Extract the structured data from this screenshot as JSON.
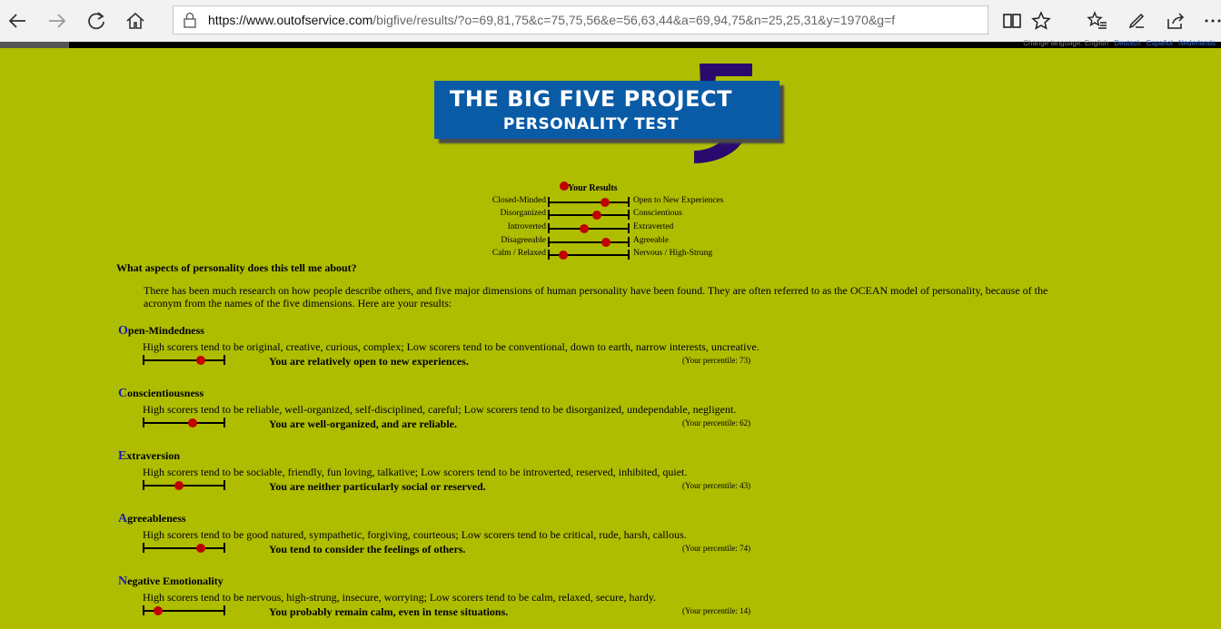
{
  "browser": {
    "url_host": "https://www.outofservice.com",
    "url_path": "/bigfive/results/?o=69,81,75&c=75,75,56&e=56,63,44&a=69,94,75&n=25,25,31&y=1970&g=f",
    "language_text": "Change language: English",
    "language_links": [
      "Deutsch",
      "Español",
      "Nederlands"
    ]
  },
  "logo": {
    "line1": "THE BIG FIVE PROJECT",
    "line2": "PERSONALITY TEST",
    "number": "5"
  },
  "summary": {
    "legend": "Your Results",
    "rows": [
      {
        "left": "Closed-Minded",
        "right": "Open to New Experiences",
        "value": 73
      },
      {
        "left": "Disorganized",
        "right": "Conscientious",
        "value": 62
      },
      {
        "left": "Introverted",
        "right": "Extraverted",
        "value": 43
      },
      {
        "left": "Disagreeable",
        "right": "Agreeable",
        "value": 74
      },
      {
        "left": "Calm / Relaxed",
        "right": "Nervous / High-Strung",
        "value": 14
      }
    ]
  },
  "question": "What aspects of personality does this tell me about?",
  "intro": "There has been much research on how people describe others, and five major dimensions of human personality have been found. They are often referred to as the OCEAN model of personality, because of the acronym from the names of the five dimensions. Here are your results:",
  "traits": [
    {
      "initial": "O",
      "rest": "pen-Mindedness",
      "desc": "High scorers tend to be original, creative, curious, complex; Low scorers tend to be conventional, down to earth, narrow interests, uncreative.",
      "verdict": "You are relatively open to new experiences.",
      "percentile_text": "(Your percentile: 73)",
      "value": 73
    },
    {
      "initial": "C",
      "rest": "onscientiousness",
      "desc": "High scorers tend to be reliable, well-organized, self-disciplined, careful; Low scorers tend to be disorganized, undependable, negligent.",
      "verdict": "You are well-organized, and are reliable.",
      "percentile_text": "(Your percentile: 62)",
      "value": 62
    },
    {
      "initial": "E",
      "rest": "xtraversion",
      "desc": "High scorers tend to be sociable, friendly, fun loving, talkative; Low scorers tend to be introverted, reserved, inhibited, quiet.",
      "verdict": "You are neither particularly social or reserved.",
      "percentile_text": "(Your percentile: 43)",
      "value": 43
    },
    {
      "initial": "A",
      "rest": "greeableness",
      "desc": "High scorers tend to be good natured, sympathetic, forgiving, courteous; Low scorers tend to be critical, rude, harsh, callous.",
      "verdict": "You tend to consider the feelings of others.",
      "percentile_text": "(Your percentile: 74)",
      "value": 74
    },
    {
      "initial": "N",
      "rest": "egative Emotionality",
      "desc": "High scorers tend to be nervous, high-strung, insecure, worrying; Low scorers tend to be calm, relaxed, secure, hardy.",
      "verdict": "You probably remain calm, even in tense situations.",
      "percentile_text": "(Your percentile: 14)",
      "value": 14
    }
  ],
  "colors": {
    "background": "#afbd00",
    "dot": "#c00000",
    "logo_blue": "#0a5ba6",
    "five_purple": "#2a0a6e",
    "initial_blue": "#1a1ab8"
  }
}
